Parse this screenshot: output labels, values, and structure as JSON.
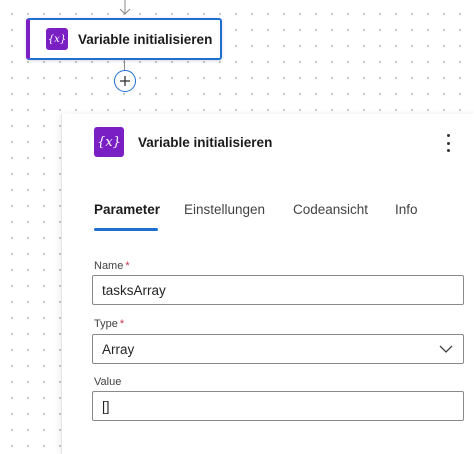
{
  "canvas": {
    "node": {
      "title": "Variable initialisieren",
      "icon": "variable-braces-icon",
      "icon_text": "{x}"
    },
    "add_step_icon": "plus-circle-icon"
  },
  "panel": {
    "header": {
      "title": "Variable initialisieren",
      "icon": "variable-braces-icon",
      "icon_text": "{x}",
      "more_icon": "more-vertical-icon"
    },
    "tabs": [
      {
        "label": "Parameter",
        "active": true
      },
      {
        "label": "Einstellungen",
        "active": false
      },
      {
        "label": "Codeansicht",
        "active": false
      },
      {
        "label": "Info",
        "active": false
      }
    ],
    "fields": {
      "name": {
        "label": "Name",
        "required_mark": "*",
        "value": "tasksArray"
      },
      "type": {
        "label": "Type",
        "required_mark": "*",
        "value": "Array"
      },
      "value": {
        "label": "Value",
        "value": "[]"
      }
    }
  },
  "colors": {
    "accent_blue": "#1f6fd1",
    "variable_purple": "#7a1fc4",
    "required_red": "#c4314b"
  }
}
